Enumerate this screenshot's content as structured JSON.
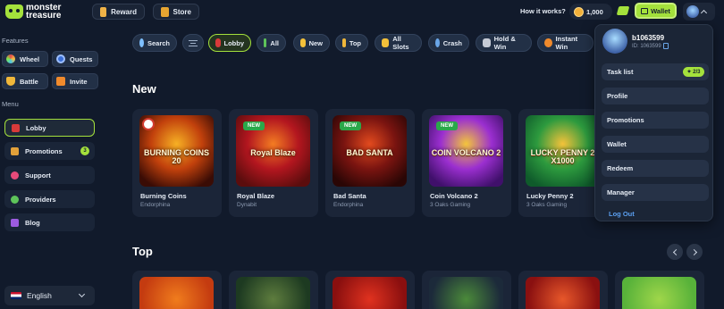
{
  "brand": {
    "line1": "monster",
    "line2": "treasure"
  },
  "header": {
    "reward_label": "Reward",
    "store_label": "Store",
    "how_label": "How it works?",
    "coins_value": "1,000",
    "wallet_label": "Wallet"
  },
  "sidebar": {
    "features_title": "Features",
    "features": [
      {
        "label": "Wheel",
        "icon": "wheel-icon"
      },
      {
        "label": "Quests",
        "icon": "quests-icon"
      },
      {
        "label": "Battle",
        "icon": "trophy-icon"
      },
      {
        "label": "Invite",
        "icon": "invite-icon"
      }
    ],
    "menu_title": "Menu",
    "menu": [
      {
        "label": "Lobby",
        "icon": "lobby-icon",
        "active": true
      },
      {
        "label": "Promotions",
        "icon": "gift-icon",
        "badge": "3"
      },
      {
        "label": "Support",
        "icon": "support-icon"
      },
      {
        "label": "Providers",
        "icon": "providers-icon"
      },
      {
        "label": "Blog",
        "icon": "blog-icon"
      }
    ],
    "language": "English"
  },
  "chips": [
    {
      "label": "Search",
      "icon": "search-icon"
    },
    {
      "label": "",
      "icon": "filter-icon"
    },
    {
      "label": "Lobby",
      "icon": "dice-icon",
      "active": true
    },
    {
      "label": "All",
      "icon": "star-icon"
    },
    {
      "label": "New",
      "icon": "lightning-icon"
    },
    {
      "label": "Top",
      "icon": "crown-icon"
    },
    {
      "label": "All Slots",
      "icon": "slots-icon"
    },
    {
      "label": "Crash",
      "icon": "rocket-icon"
    },
    {
      "label": "Hold & Win",
      "icon": "hold-win-icon"
    },
    {
      "label": "Instant Win",
      "icon": "instant-icon"
    }
  ],
  "sections": {
    "new_title": "New",
    "top_title": "Top"
  },
  "new_games": [
    {
      "name": "Burning Coins",
      "provider": "Endorphina",
      "art": "BURNING COINS 20",
      "badge": "",
      "colors": [
        "#3a0c05",
        "#c2410c",
        "#f6b024"
      ]
    },
    {
      "name": "Royal Blaze",
      "provider": "Dynabit",
      "art": "Royal Blaze",
      "badge": "NEW",
      "colors": [
        "#5b0d0d",
        "#b3161f",
        "#f37c22"
      ]
    },
    {
      "name": "Bad Santa",
      "provider": "Endorphina",
      "art": "BAD SANTA",
      "badge": "NEW",
      "colors": [
        "#2a0605",
        "#7a1410",
        "#e24a1e"
      ]
    },
    {
      "name": "Coin Volcano 2",
      "provider": "3 Oaks Gaming",
      "art": "COIN VOLCANO 2",
      "badge": "NEW",
      "colors": [
        "#40106b",
        "#9b2fd0",
        "#f3c53b"
      ]
    },
    {
      "name": "Lucky Penny 2",
      "provider": "3 Oaks Gaming",
      "art": "LUCKY PENNY 2 X1000",
      "badge": "",
      "colors": [
        "#0f5b2b",
        "#2d9a3e",
        "#f4c23a"
      ]
    }
  ],
  "top_game_colors": [
    [
      "#c43b10",
      "#f07c1d"
    ],
    [
      "#1d3a21",
      "#5e7d3e"
    ],
    [
      "#8a0f0f",
      "#e0321f"
    ],
    [
      "#1c2a3a",
      "#4b8a3a"
    ],
    [
      "#8a1010",
      "#e7572a"
    ],
    [
      "#58b23a",
      "#9fd64a"
    ]
  ],
  "dropdown": {
    "username": "b1063599",
    "user_id": "ID: 1063599",
    "task_label": "Task list",
    "task_progress": "2/3",
    "items": [
      "Profile",
      "Promotions",
      "Wallet",
      "Redeem",
      "Manager"
    ],
    "logout": "Log Out"
  }
}
